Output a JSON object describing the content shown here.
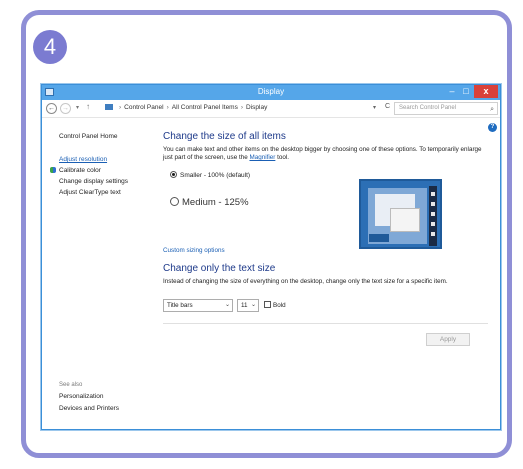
{
  "step": {
    "number": "4"
  },
  "window": {
    "title": "Display",
    "controls": {
      "minimize": "–",
      "maximize": "□",
      "close": "x"
    }
  },
  "address": {
    "back": "←",
    "forward": "→",
    "up": "↑",
    "breadcrumb": [
      "Control Panel",
      "All Control Panel Items",
      "Display"
    ],
    "refresh": "C",
    "search_placeholder": "Search Control Panel",
    "search_icon": "⌕"
  },
  "help": {
    "label": "?"
  },
  "sidebar": {
    "home": "Control Panel Home",
    "items": [
      "Adjust resolution",
      "Calibrate color",
      "Change display settings",
      "Adjust ClearType text"
    ],
    "see_also_title": "See also",
    "see_also": [
      "Personalization",
      "Devices and Printers"
    ]
  },
  "main": {
    "heading": "Change the size of all items",
    "description_part1": "You can make text and other items on the desktop bigger by choosing one of these options. To temporarily enlarge just part of the screen, use the ",
    "magnifier_link": "Magnifier",
    "description_part2": " tool.",
    "options": [
      {
        "label": "Smaller - 100% (default)",
        "checked": true
      },
      {
        "label": "Medium - 125%",
        "checked": false
      }
    ],
    "custom_sizing_link": "Custom sizing options",
    "text_heading": "Change only the text size",
    "text_description": "Instead of changing the size of everything on the desktop, change only the text size for a specific item.",
    "item_select_value": "Title bars",
    "size_select_value": "11",
    "bold_label": "Bold",
    "apply_label": "Apply"
  },
  "colors": {
    "frame_border": "#8f8fd6",
    "badge": "#7b7bd1",
    "titlebar": "#55a6e9",
    "heading": "#1e3a8a",
    "link": "#1a5fb4"
  }
}
